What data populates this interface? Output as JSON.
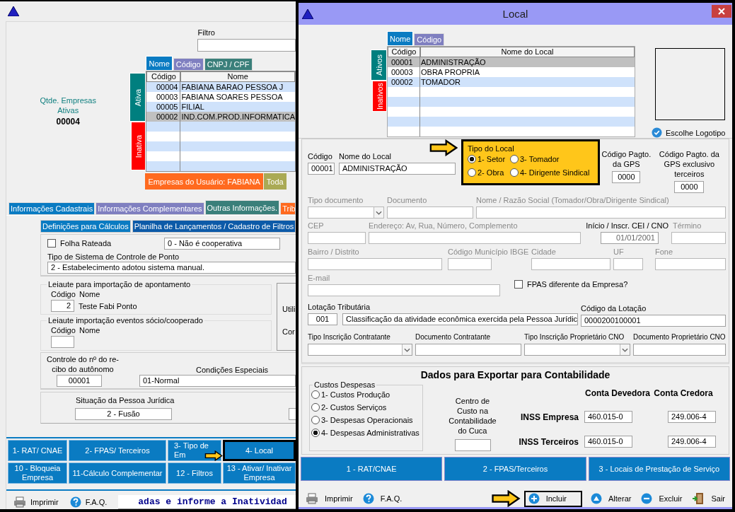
{
  "main_window": {
    "filter": {
      "label": "Filtro"
    },
    "count": {
      "label": "Qtde. Empresas Ativas",
      "value": "00004"
    },
    "list_tabs": [
      {
        "label": "Nome",
        "selected": true,
        "color": "#0a7bc2"
      },
      {
        "label": "Código",
        "selected": false,
        "color": "#7f7fc0"
      },
      {
        "label": "CNPJ / CPF",
        "selected": false,
        "color": "#3a7f7a"
      }
    ],
    "side_tabs": [
      {
        "label": "Ativa",
        "selected": true,
        "color": "#007f7f"
      },
      {
        "label": "Inativa",
        "selected": false,
        "color": "#ff0000"
      }
    ],
    "columns": [
      "Código",
      "Nome"
    ],
    "rows": [
      {
        "code": "00004",
        "name": "FABIANA BARAO PESSOA J",
        "selected": false
      },
      {
        "code": "00003",
        "name": "FABIANA SOARES PESSOA",
        "selected": false
      },
      {
        "code": "00005",
        "name": "FILIAL",
        "selected": false
      },
      {
        "code": "00002",
        "name": "IND.COM.PROD.INFORMATICA",
        "selected": true
      }
    ],
    "user_tabs": [
      {
        "label": "Empresas do Usuário: FABIANA",
        "color": "#ff6a1f"
      },
      {
        "label": "Toda",
        "color": "#aaaa55"
      }
    ],
    "section_tabs": [
      {
        "label": "Informações Cadastrais",
        "selected": false,
        "color": "#0a7bc2"
      },
      {
        "label": "Informações Complementares",
        "selected": false,
        "color": "#7f7fc0"
      },
      {
        "label": "Outras Informações.",
        "selected": true,
        "color": "#3a7f7a"
      },
      {
        "label": "Trib",
        "selected": false,
        "color": "#ff6a1f"
      }
    ],
    "sub_tabs": [
      {
        "label": "Definições para Cálculos",
        "selected": true
      },
      {
        "label": "Planilha de Lançamentos / Cadastro de Filtros",
        "selected": false
      }
    ],
    "folha_rateada": {
      "label": "Folha Rateada",
      "checked": false
    },
    "cooperativa": "0 - Não é cooperativa",
    "ponto": {
      "label": "Tipo de Sistema de Controle de Ponto",
      "value": "2 - Estabelecimento adotou sistema manual."
    },
    "leiaute_apontamento": {
      "title": "Leiaute para importação de apontamento",
      "code_label": "Código",
      "name_label": "Nome",
      "code": "2",
      "name": "Teste Fabi Ponto"
    },
    "leiaute_eventos": {
      "title": "Leiaute importação eventos sócio/cooperado",
      "code_label": "Código",
      "name_label": "Nome"
    },
    "side_box": [
      "Utili",
      "Cor"
    ],
    "recibo": {
      "label": "Controle do nº do re-cibo do autônomo",
      "value": "00001"
    },
    "condicoes": {
      "label": "Condições Especiais",
      "value": "01-Normal"
    },
    "situacao": {
      "label": "Situação da Pessoa Jurídica",
      "value": "2 - Fusão"
    },
    "buttons": [
      {
        "label": "1- RAT/ CNAE",
        "highlighted": false
      },
      {
        "label": "2- FPAS/ Terceiros",
        "highlighted": false
      },
      {
        "label": "3- Tipo de Em",
        "highlighted": false
      },
      {
        "label": "4- Local",
        "highlighted": true
      },
      {
        "label": "10 - Bloqueia Empresa",
        "highlighted": false
      },
      {
        "label": "11-Cálculo Complementar",
        "highlighted": false
      },
      {
        "label": "12 - Filtros",
        "highlighted": false
      },
      {
        "label": "13 - Ativar/ Inativar Empresa",
        "highlighted": false
      }
    ],
    "footer": {
      "print": "Imprimir",
      "faq": "F.A.Q.",
      "ticker": "adas e informe a Inatividad"
    }
  },
  "local_window": {
    "title": "Local",
    "list_tabs": [
      {
        "label": "Nome",
        "selected": true,
        "color": "#0a7bc2"
      },
      {
        "label": "Código",
        "selected": false,
        "color": "#7f7fc0"
      }
    ],
    "side_tabs": [
      {
        "label": "Ativos",
        "selected": true,
        "color": "#007f7f"
      },
      {
        "label": "Inativos",
        "selected": false,
        "color": "#ff0000"
      }
    ],
    "columns": [
      "Código",
      "Nome do Local"
    ],
    "rows": [
      {
        "code": "00001",
        "name": "ADMINISTRAÇÃO",
        "selected": true
      },
      {
        "code": "00003",
        "name": "OBRA PROPRIA",
        "selected": false
      },
      {
        "code": "00002",
        "name": "TOMADOR",
        "selected": false
      }
    ],
    "logo_button": "Escolhe Logotipo",
    "codigo": {
      "label": "Código",
      "value": "00001"
    },
    "nome": {
      "label": "Nome do Local",
      "value": "ADMINISTRAÇÃO"
    },
    "tipo_local": {
      "title": "Tipo do Local",
      "highlighted": true,
      "options": [
        {
          "label": "1- Setor",
          "selected": true
        },
        {
          "label": "3- Tomador",
          "selected": false
        },
        {
          "label": "2- Obra",
          "selected": false
        },
        {
          "label": "4- Dirigente Sindical",
          "selected": false
        }
      ]
    },
    "gps": [
      {
        "label": "Código Pagto. da GPS",
        "value": "0000"
      },
      {
        "label": "Código Pagto. da GPS exclusivo terceiros",
        "value": "0000"
      }
    ],
    "field_rows": [
      [
        {
          "label": "Tipo documento",
          "kind": "select",
          "disabled": true
        },
        {
          "label": "Documento",
          "kind": "text",
          "disabled": true
        },
        {
          "label": "Nome / Razão Social (Tomador/Obra/Dirigente Sindical)",
          "kind": "text",
          "disabled": true
        }
      ],
      [
        {
          "label": "CEP",
          "kind": "text",
          "disabled": true
        },
        {
          "label": "Endereço: Av, Rua, Número, Complemento",
          "kind": "text",
          "disabled": true
        },
        {
          "label": "Início / Inscr. CEI / CNO",
          "kind": "text",
          "value": "01/01/2001",
          "disabled": false
        },
        {
          "label": "Término",
          "kind": "text",
          "disabled": true
        }
      ],
      [
        {
          "label": "Bairro / Distrito",
          "kind": "text",
          "disabled": true
        },
        {
          "label": "Código Município IBGE",
          "kind": "text",
          "disabled": true
        },
        {
          "label": "Cidade",
          "kind": "text",
          "disabled": true
        },
        {
          "label": "UF",
          "kind": "text",
          "disabled": true
        },
        {
          "label": "Fone",
          "kind": "text",
          "disabled": true
        }
      ]
    ],
    "email": {
      "label": "E-mail",
      "disabled": true
    },
    "fpas": {
      "label": "FPAS diferente da Empresa?",
      "checked": false
    },
    "lotacao": {
      "label": "Lotação Tributária",
      "code": "001",
      "value": "Classificação da atividade econômica exercida pela Pessoa Jurídic"
    },
    "codigo_lotacao": {
      "label": "Código da Lotação",
      "value": "0000200100001"
    },
    "contratante_row": [
      {
        "label": "Tipo Inscrição Contratante",
        "kind": "select",
        "disabled": false
      },
      {
        "label": "Documento Contratante",
        "kind": "text",
        "disabled": false
      },
      {
        "label": "Tipo Inscrição Proprietário CNO",
        "kind": "select",
        "disabled": false
      },
      {
        "label": "Documento Proprietário CNO",
        "kind": "text",
        "disabled": false
      }
    ],
    "export": {
      "title": "Dados para Exportar para Contabilidade",
      "custos": {
        "title": "Custos Despesas",
        "options": [
          {
            "label": "1- Custos Produção",
            "selected": false
          },
          {
            "label": "2- Custos Serviços",
            "selected": false
          },
          {
            "label": "3- Despesas Operacionais",
            "selected": false
          },
          {
            "label": "4- Despesas Administrativas",
            "selected": true
          }
        ]
      },
      "centro": {
        "label": "Centro de Custo na Contabilidade do Cuca"
      },
      "columns": [
        "Conta Devedora",
        "Conta Credora"
      ],
      "accounts": [
        {
          "label": "INSS Empresa",
          "debit": "460.015-0",
          "credit": "249.006-4"
        },
        {
          "label": "INSS Terceiros",
          "debit": "460.015-0",
          "credit": "249.006-4"
        }
      ]
    },
    "buttons": [
      "1 - RAT/CNAE",
      "2 - FPAS/Terceiros",
      "3 - Locais de Prestação de Serviço"
    ],
    "footer": [
      {
        "kind": "print",
        "label": "Imprimir",
        "highlighted": false
      },
      {
        "kind": "faq",
        "label": "F.A.Q.",
        "highlighted": false
      },
      {
        "kind": "add",
        "label": "Incluir",
        "highlighted": true
      },
      {
        "kind": "edit",
        "label": "Alterar",
        "highlighted": false
      },
      {
        "kind": "delete",
        "label": "Excluir",
        "highlighted": false
      },
      {
        "kind": "exit",
        "label": "Sair",
        "highlighted": false
      }
    ]
  }
}
